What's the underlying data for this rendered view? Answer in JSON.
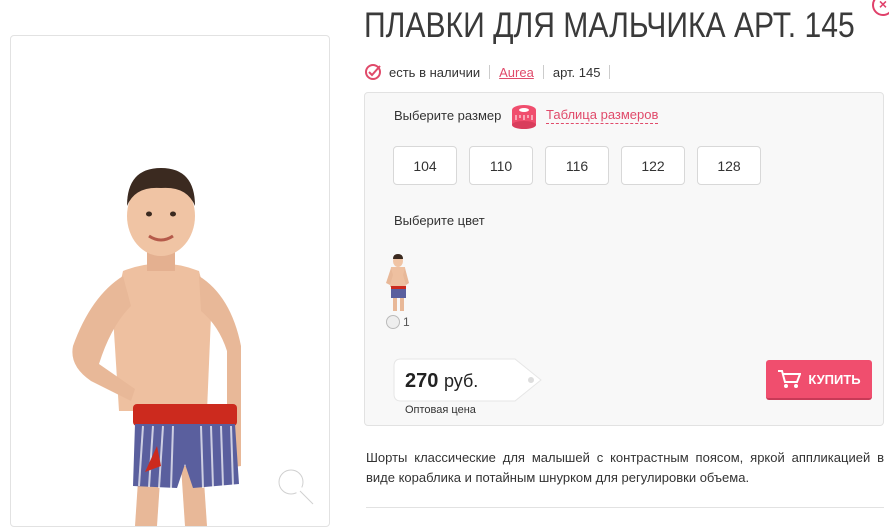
{
  "product": {
    "title": "ПЛАВКИ ДЛЯ МАЛЬЧИКА АРТ. 145",
    "availability": "есть в наличии",
    "brand": "Aurea",
    "article": "арт. 145"
  },
  "icons": {
    "close": "close-icon",
    "availability": "check-circle-icon",
    "size_table": "measuring-tape-icon",
    "zoom": "magnifier-icon",
    "cart": "cart-icon"
  },
  "options": {
    "size_label": "Выберите размер",
    "size_table_link": "Таблица размеров",
    "sizes": [
      "104",
      "110",
      "116",
      "122",
      "128"
    ],
    "color_label": "Выберите цвет",
    "color_option_label": "1"
  },
  "price": {
    "value": "270",
    "currency": "руб.",
    "note": "Оптовая цена"
  },
  "buy_label": "КУПИТЬ",
  "description": "Шорты классические для малышей с контрастным поясом, яркой аппликацией в виде кораблика и потайным шнурком для регулировки объема.",
  "colors": {
    "accent": "#f04e6e",
    "link": "#e04a6a"
  }
}
